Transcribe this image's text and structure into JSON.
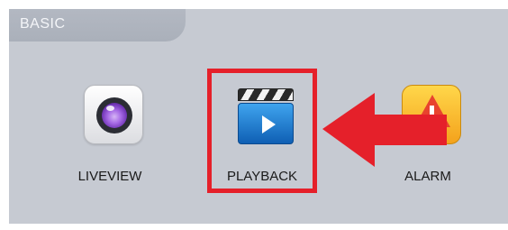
{
  "tab": {
    "label": "BASIC"
  },
  "items": [
    {
      "label": "LIVEVIEW",
      "icon": "camera-lens-icon"
    },
    {
      "label": "PLAYBACK",
      "icon": "clapperboard-play-icon"
    },
    {
      "label": "ALARM",
      "icon": "alarm-warning-icon"
    }
  ],
  "annotation": {
    "highlight_target": "PLAYBACK",
    "arrow_color": "#e5202a",
    "highlight_color": "#e5202a"
  }
}
